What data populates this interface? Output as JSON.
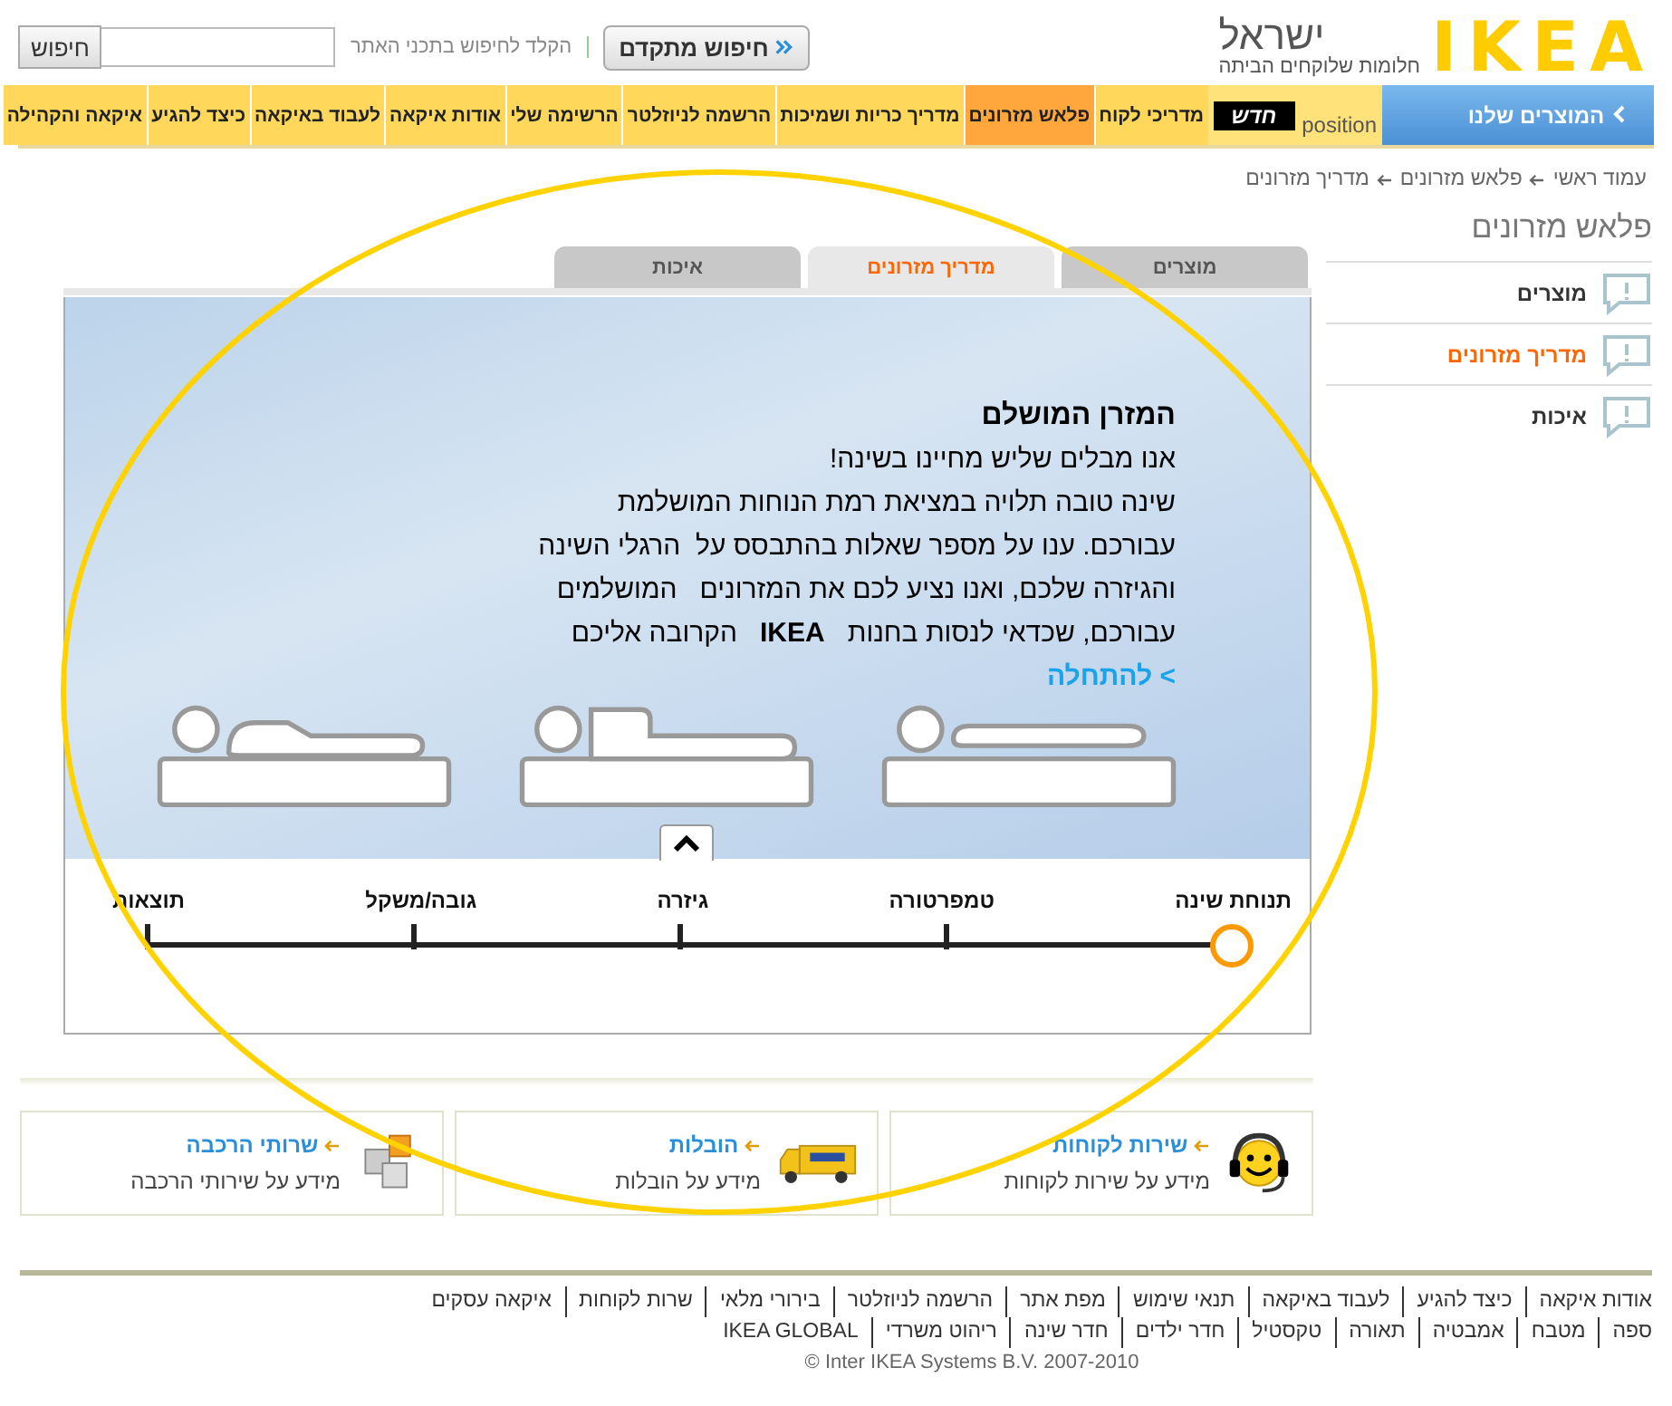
{
  "header": {
    "logo": "IKEA",
    "country": "ישראל",
    "slogan": "חלומות שלוקחים הביתה",
    "advanced_search": "חיפוש מתקדם",
    "search_hint": "הקלד לחיפוש בתכני האתר",
    "search_button": "חיפוש"
  },
  "nav": {
    "products": "המוצרים שלנו",
    "position": "position",
    "new_badge": "חדש",
    "items": [
      {
        "label": "מדריכי לקוח",
        "selected": false
      },
      {
        "label": "פלאש מזרונים",
        "selected": true
      },
      {
        "label": "מדריך כריות ושמיכות",
        "selected": false
      },
      {
        "label": "הרשמה לניוזלטר",
        "selected": false
      },
      {
        "label": "הרשימה שלי",
        "selected": false
      },
      {
        "label": "אודות איקאה",
        "selected": false
      },
      {
        "label": "לעבוד באיקאה",
        "selected": false
      },
      {
        "label": "כיצד להגיע",
        "selected": false
      },
      {
        "label": "איקאה והקהילה",
        "selected": false
      }
    ]
  },
  "breadcrumb": [
    "עמוד ראשי",
    "פלאש מזרונים",
    "מדריך מזרונים"
  ],
  "sidebar": {
    "title": "פלאש מזרונים",
    "items": [
      {
        "label": "מוצרים",
        "selected": false
      },
      {
        "label": "מדריך מזרונים",
        "selected": true
      },
      {
        "label": "איכות",
        "selected": false
      }
    ]
  },
  "tabs": [
    {
      "label": "מוצרים",
      "selected": false
    },
    {
      "label": "מדריך מזרונים",
      "selected": true
    },
    {
      "label": "איכות",
      "selected": false
    }
  ],
  "intro": {
    "title": "המזרן המושלם",
    "lines": [
      "אנו מבלים שליש מחיינו בשינה!",
      "שינה טובה תלויה במציאת רמת הנוחות המושלמת",
      "עבורכם. ענו על מספר שאלות בהתבסס על  הרגלי השינה",
      "והגיזרה שלכם, ואנו נציע לכם את המזרונים   המושלמים",
      "עבורכם, שכדאי לנסות בחנות   **IKEA**   הקרובה אליכם"
    ],
    "start_link": "> להתחלה"
  },
  "steps": [
    {
      "label": "תנוחת שינה",
      "selected": true
    },
    {
      "label": "טמפרטורה",
      "selected": false
    },
    {
      "label": "גיזרה",
      "selected": false
    },
    {
      "label": "גובה/משקל",
      "selected": false
    },
    {
      "label": "תוצאות",
      "selected": false
    }
  ],
  "services": [
    {
      "title": "שירות לקוחות",
      "text": "מידע על שירות לקוחות",
      "kind": "support"
    },
    {
      "title": "הובלות",
      "text": "מידע על הובלות",
      "kind": "truck"
    },
    {
      "title": "שרותי הרכבה",
      "text": "מידע על שירותי הרכבה",
      "kind": "puzzle"
    }
  ],
  "footer": {
    "row_1": [
      "אודות איקאה",
      "כיצד להגיע",
      "לעבוד באיקאה",
      "תנאי שימוש",
      "מפת אתר",
      "הרשמה לניוזלטר",
      "בירורי מלאי",
      "שרות לקוחות",
      "איקאה עסקים"
    ],
    "row_2": [
      "ספה",
      "מטבח",
      "אמבטיה",
      "תאורה",
      "טקסטיל",
      "חדר ילדים",
      "חדר שינה",
      "ריהוט משרדי",
      "IKEA GLOBAL"
    ],
    "copyright": "© Inter IKEA Systems B.V. 2007-2010"
  }
}
